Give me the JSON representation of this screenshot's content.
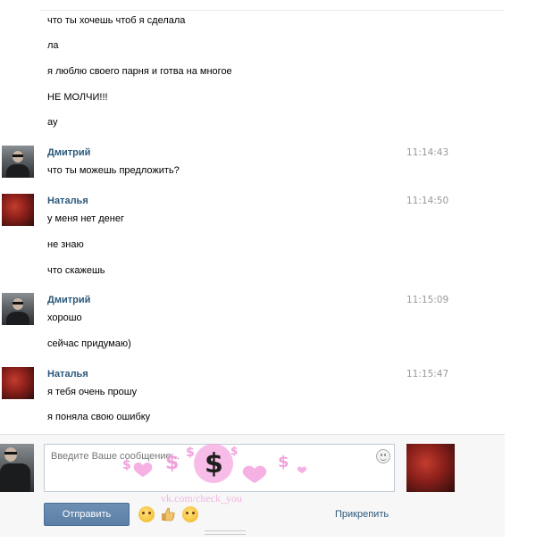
{
  "messages_top": [
    "что ты хочешь чтоб я сделала",
    "ла",
    "я люблю своего парня и готва на многое",
    "НЕ МОЛЧИ!!!",
    "ау"
  ],
  "groups": [
    {
      "author": "Дмитрий",
      "time": "11:14:43",
      "avatar": "dmitry",
      "lines": [
        "что ты можешь предложить?"
      ]
    },
    {
      "author": "Наталья",
      "time": "11:14:50",
      "avatar": "natalia",
      "lines": [
        "у меня нет денег",
        "не знаю",
        "что скажешь"
      ]
    },
    {
      "author": "Дмитрий",
      "time": "11:15:09",
      "avatar": "dmitry",
      "lines": [
        "хорошо",
        "сейчас придумаю)"
      ]
    },
    {
      "author": "Наталья",
      "time": "11:15:47",
      "avatar": "natalia",
      "lines": [
        "я тебя очень прошу",
        "я поняла свою ошибку"
      ]
    }
  ],
  "composer": {
    "placeholder": "Введите Ваше сообщение...",
    "send_label": "Отправить",
    "attach_label": "Прикрепить",
    "emojis": [
      "confused-face-icon",
      "thumbs-up-icon",
      "wink-face-icon"
    ]
  },
  "watermark": {
    "text": "vk.com/check_you",
    "symbol": "$"
  },
  "colors": {
    "author": "#2b587a",
    "send_button": "#5b7fa6",
    "time": "#999999",
    "watermark": "#f2b6e4"
  }
}
